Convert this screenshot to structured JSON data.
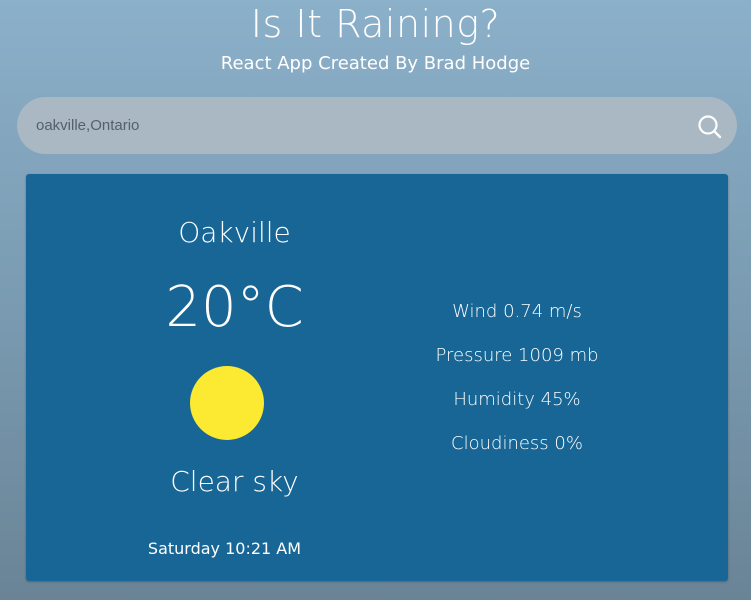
{
  "header": {
    "title": "Is It Raining?",
    "subtitle": "React App Created By Brad Hodge"
  },
  "search": {
    "value": "oakville,Ontario",
    "icon": "search-icon"
  },
  "weather": {
    "city": "Oakville",
    "temperature": "20°C",
    "icon": "sun-icon",
    "condition": "Clear sky",
    "datetime": "Saturday 10:21 AM",
    "details": [
      {
        "label": "Wind",
        "value": "0.74 m/s",
        "text": "Wind 0.74 m/s"
      },
      {
        "label": "Pressure",
        "value": "1009 mb",
        "text": "Pressure 1009 mb"
      },
      {
        "label": "Humidity",
        "value": "45%",
        "text": "Humidity 45%"
      },
      {
        "label": "Cloudiness",
        "value": "0%",
        "text": "Cloudiness 0%"
      }
    ]
  },
  "colors": {
    "card_background": "#176696",
    "sun": "#fbe932",
    "search_background": "#a9b8c3",
    "text": "#ffffff"
  }
}
